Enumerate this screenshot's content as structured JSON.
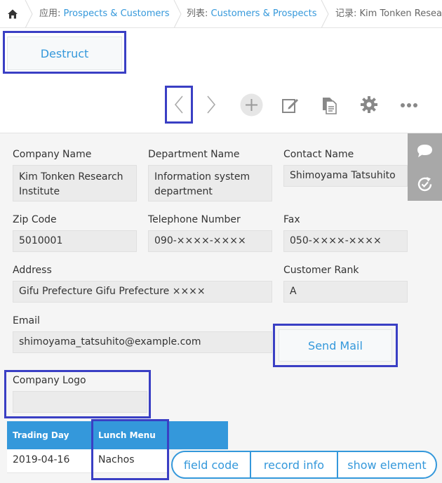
{
  "breadcrumb": {
    "home_icon": "home-icon",
    "app_prefix": "应用: ",
    "app_name": "Prospects & Customers",
    "view_prefix": "列表: ",
    "view_name": "Customers & Prospects",
    "record_prefix": "记录: ",
    "record_name": "Kim Tonken Research Institute"
  },
  "toolbar": {
    "destruct_label": "Destruct",
    "icons": [
      "chevron-left-icon",
      "chevron-right-icon",
      "add-icon",
      "edit-icon",
      "duplicate-icon",
      "gear-icon",
      "more-icon"
    ]
  },
  "form": {
    "company_name_label": "Company Name",
    "company_name_line1": "Kim Tonken Research",
    "company_name_line2": "Institute",
    "department_label": "Department Name",
    "department_line1": "Information system",
    "department_line2": "department",
    "contact_label": "Contact Name",
    "contact_value": "Shimoyama Tatsuhito",
    "zip_label": "Zip Code",
    "zip_value": "5010001",
    "tel_label": "Telephone Number",
    "tel_value": "090-××××-××××",
    "fax_label": "Fax",
    "fax_value": "050-××××-××××",
    "address_label": "Address",
    "address_value": "Gifu Prefecture Gifu Prefecture ××××",
    "rank_label": "Customer Rank",
    "rank_value": "A",
    "email_label": "Email",
    "email_value": "shimoyama_tatsuhito@example.com",
    "send_mail_label": "Send Mail",
    "logo_label": "Company Logo",
    "logo_value": ""
  },
  "side_panel": {
    "icons": [
      "comment-icon",
      "history-icon"
    ]
  },
  "table": {
    "headers": [
      "Trading Day",
      "Lunch Menu"
    ],
    "rows": [
      [
        "2019-04-16",
        "Nachos"
      ]
    ]
  },
  "bottom_bar": {
    "field_code": "field code",
    "record_info": "record info",
    "show_element": "show element"
  },
  "colors": {
    "accent": "#3498db",
    "highlight": "#3a3fc4"
  }
}
